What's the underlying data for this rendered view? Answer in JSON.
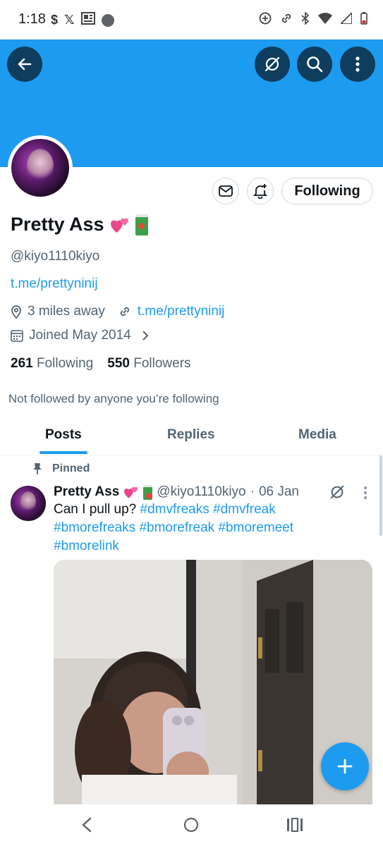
{
  "status_bar": {
    "time": "1:18",
    "left_icons": [
      "dollar-icon",
      "x-icon",
      "news-icon",
      "dot-icon"
    ],
    "right_icons": [
      "add-circle-icon",
      "link-icon",
      "bluetooth-icon",
      "wifi-icon",
      "signal-icon",
      "battery-icon"
    ]
  },
  "header": {
    "banner_color": "#1d9bf0",
    "buttons": [
      "back-icon",
      "grok-icon",
      "search-icon",
      "more-icon"
    ]
  },
  "profile": {
    "name": "Pretty Ass",
    "name_emojis": [
      "two-hearts-emoji",
      "juice-box-emoji"
    ],
    "handle": "@kiyo1110kiyo",
    "bio_link": "t.me/prettyninij",
    "location": "3 miles away",
    "website": "t.me/prettyninij",
    "joined": "Joined May 2014",
    "following_count": "261",
    "following_label": "Following",
    "followers_count": "550",
    "followers_label": "Followers",
    "not_followed_text": "Not followed by anyone you’re following",
    "follow_button": "Following"
  },
  "tabs": [
    {
      "label": "Posts",
      "active": true
    },
    {
      "label": "Replies",
      "active": false
    },
    {
      "label": "Media",
      "active": false
    }
  ],
  "pinned_post": {
    "pinned_label": "Pinned",
    "author_name": "Pretty Ass",
    "author_handle": "@kiyo1110kiyo",
    "separator": "·",
    "date": "06 Jan",
    "text_plain": "Can I pull up?",
    "hashtags": [
      "#dmvfreaks",
      "#dmvfreak",
      "#bmorefreaks",
      "#bmorefreak",
      "#bmoremeet",
      "#bmorelink"
    ]
  },
  "colors": {
    "accent": "#1d9bf0",
    "text_primary": "#0f1419",
    "text_secondary": "#536471",
    "header_button": "#0f3d5e"
  }
}
